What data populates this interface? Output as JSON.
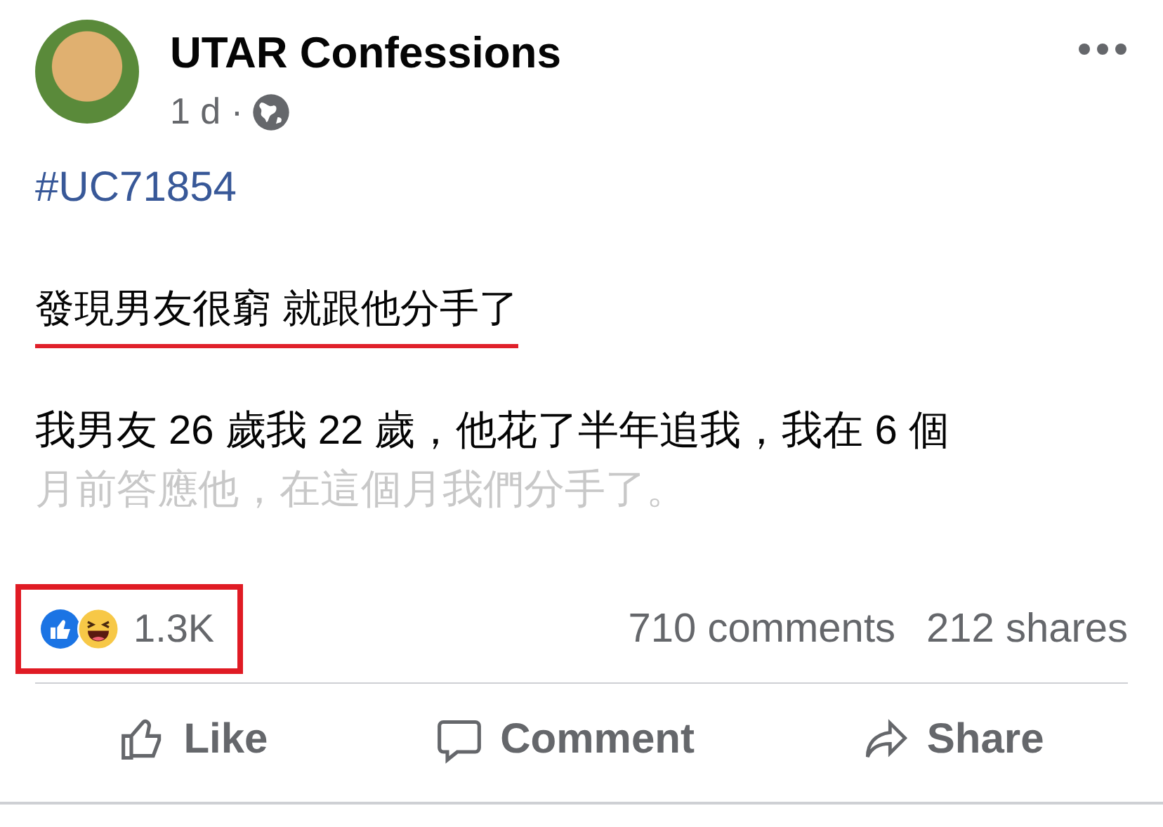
{
  "post": {
    "author": "UTAR Confessions",
    "time": "1 d ·",
    "hashtag": "#UC71854",
    "headline": {
      "text": "發現男友很窮 就跟他分手了",
      "underlined": true
    },
    "body_lines": [
      {
        "text": "我男友 26 歲我 22 歲，他花了半年追我，我在 6 個",
        "faded": false
      },
      {
        "text": "月前答應他，在這個月我們分手了。",
        "faded": true
      }
    ]
  },
  "stats": {
    "reactions": "1.3K",
    "highlighted": true,
    "comments": "710 comments",
    "shares": "212 shares"
  },
  "actions": [
    {
      "kind": "like",
      "label": "Like"
    },
    {
      "kind": "comment",
      "label": "Comment"
    },
    {
      "kind": "share",
      "label": "Share"
    }
  ]
}
